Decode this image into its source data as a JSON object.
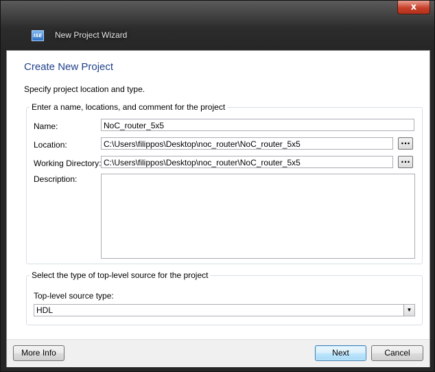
{
  "window": {
    "title": "New Project Wizard",
    "app_icon": "ise-app-icon",
    "close_symbol": "x"
  },
  "page": {
    "heading": "Create New Project",
    "description": "Specify project location and type."
  },
  "project_group": {
    "legend": "Enter a name, locations, and comment for the project",
    "name_label": "Name:",
    "name_value": "NoC_router_5x5",
    "location_label": "Location:",
    "location_value": "C:\\Users\\filippos\\Desktop\\noc_router\\NoC_router_5x5",
    "working_dir_label": "Working Directory:",
    "working_dir_value": "C:\\Users\\filippos\\Desktop\\noc_router\\NoC_router_5x5",
    "description_label": "Description:",
    "description_value": "",
    "browse_label": "..."
  },
  "source_group": {
    "legend": "Select the type of top-level source for the project",
    "type_label": "Top-level source type:",
    "type_value": "HDL"
  },
  "footer": {
    "more_info_label": "More Info",
    "next_label": "Next",
    "cancel_label": "Cancel"
  }
}
